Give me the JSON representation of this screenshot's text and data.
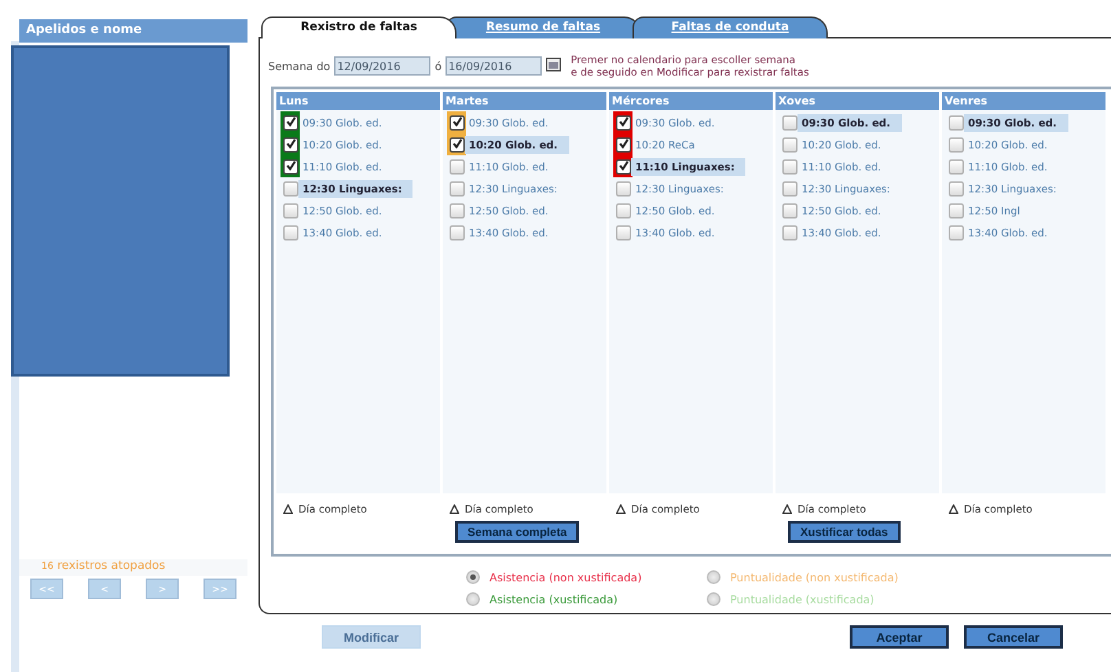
{
  "sidebar": {
    "header": "Apelidos e nome",
    "count": "16",
    "count_label": "rexistros atopados",
    "pager": [
      "<<",
      "<",
      ">",
      ">>"
    ]
  },
  "tabs": [
    {
      "label": "Rexistro de faltas",
      "selected": true
    },
    {
      "label": "Resumo de faltas",
      "selected": false
    },
    {
      "label": "Faltas de conduta",
      "selected": false
    }
  ],
  "week": {
    "label": "Semana do",
    "from": "12/09/2016",
    "sep": "ó",
    "to": "16/09/2016",
    "hint": "Premer no calendario para escoller semana\ne de seguido en Modificar para rexistrar faltas"
  },
  "days": [
    {
      "name": "Luns",
      "footer": "Día completo",
      "slots": [
        {
          "time": "09:30",
          "subject": "Glob. ed.",
          "checked": true,
          "selected": false,
          "color": "#0a7a1a"
        },
        {
          "time": "10:20",
          "subject": "Glob. ed.",
          "checked": true,
          "selected": false,
          "color": "#0a7a1a"
        },
        {
          "time": "11:10",
          "subject": "Glob. ed.",
          "checked": true,
          "selected": false,
          "color": "#0a7a1a"
        },
        {
          "time": "12:30",
          "subject": "Linguaxes:",
          "checked": false,
          "selected": true
        },
        {
          "time": "12:50",
          "subject": "Glob. ed.",
          "checked": false,
          "selected": false
        },
        {
          "time": "13:40",
          "subject": "Glob. ed.",
          "checked": false,
          "selected": false
        }
      ]
    },
    {
      "name": "Martes",
      "footer": "Día completo",
      "button": "Semana completa",
      "slots": [
        {
          "time": "09:30",
          "subject": "Glob. ed.",
          "checked": true,
          "selected": false,
          "color": "#f0b040"
        },
        {
          "time": "10:20",
          "subject": "Glob. ed.",
          "checked": true,
          "selected": true,
          "color": "#f0b040"
        },
        {
          "time": "11:10",
          "subject": "Glob. ed.",
          "checked": false,
          "selected": false
        },
        {
          "time": "12:30",
          "subject": "Linguaxes:",
          "checked": false,
          "selected": false
        },
        {
          "time": "12:50",
          "subject": "Glob. ed.",
          "checked": false,
          "selected": false
        },
        {
          "time": "13:40",
          "subject": "Glob. ed.",
          "checked": false,
          "selected": false
        }
      ]
    },
    {
      "name": "Mércores",
      "footer": "Día completo",
      "slots": [
        {
          "time": "09:30",
          "subject": "Glob. ed.",
          "checked": true,
          "selected": false,
          "color": "#e00000"
        },
        {
          "time": "10:20",
          "subject": "ReCa",
          "checked": true,
          "selected": false,
          "color": "#e00000"
        },
        {
          "time": "11:10",
          "subject": "Linguaxes:",
          "checked": true,
          "selected": true,
          "color": "#e00000"
        },
        {
          "time": "12:30",
          "subject": "Linguaxes:",
          "checked": false,
          "selected": false
        },
        {
          "time": "12:50",
          "subject": "Glob. ed.",
          "checked": false,
          "selected": false
        },
        {
          "time": "13:40",
          "subject": "Glob. ed.",
          "checked": false,
          "selected": false
        }
      ]
    },
    {
      "name": "Xoves",
      "footer": "Día completo",
      "button": "Xustificar todas",
      "slots": [
        {
          "time": "09:30",
          "subject": "Glob. ed.",
          "checked": false,
          "selected": true
        },
        {
          "time": "10:20",
          "subject": "Glob. ed.",
          "checked": false,
          "selected": false
        },
        {
          "time": "11:10",
          "subject": "Glob. ed.",
          "checked": false,
          "selected": false
        },
        {
          "time": "12:30",
          "subject": "Linguaxes:",
          "checked": false,
          "selected": false
        },
        {
          "time": "12:50",
          "subject": "Glob. ed.",
          "checked": false,
          "selected": false
        },
        {
          "time": "13:40",
          "subject": "Glob. ed.",
          "checked": false,
          "selected": false
        }
      ]
    },
    {
      "name": "Venres",
      "footer": "Día completo",
      "slots": [
        {
          "time": "09:30",
          "subject": "Glob. ed.",
          "checked": false,
          "selected": true
        },
        {
          "time": "10:20",
          "subject": "Glob. ed.",
          "checked": false,
          "selected": false
        },
        {
          "time": "11:10",
          "subject": "Glob. ed.",
          "checked": false,
          "selected": false
        },
        {
          "time": "12:30",
          "subject": "Linguaxes:",
          "checked": false,
          "selected": false
        },
        {
          "time": "12:50",
          "subject": "Ingl",
          "checked": false,
          "selected": false
        },
        {
          "time": "13:40",
          "subject": "Glob. ed.",
          "checked": false,
          "selected": false
        }
      ]
    }
  ],
  "legend": [
    {
      "label": "Asistencia (non xustificada)",
      "selected": true,
      "color": "#e8304a"
    },
    {
      "label": "Puntualidade (non xustificada)",
      "selected": false,
      "color": "#f4b870"
    },
    {
      "label": "Asistencia (xustificada)",
      "selected": false,
      "color": "#3a9a3a"
    },
    {
      "label": "Puntualidade (xustificada)",
      "selected": false,
      "color": "#a8dca0"
    }
  ],
  "actions": [
    {
      "label": "Modificar",
      "disabled": true
    },
    {
      "label": "Aceptar",
      "disabled": false
    },
    {
      "label": "Cancelar",
      "disabled": false
    }
  ]
}
